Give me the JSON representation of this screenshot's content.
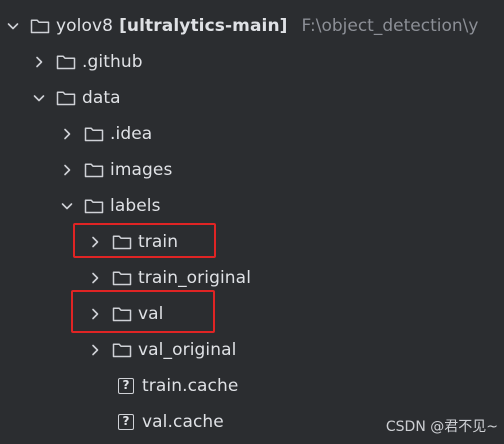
{
  "tree": {
    "root": {
      "name": "yolov8",
      "module": "[ultralytics-main]",
      "path": "F:\\object_detection\\y"
    },
    "items": [
      {
        "name": ".github",
        "kind": "folder",
        "state": "collapsed"
      },
      {
        "name": "data",
        "kind": "folder",
        "state": "expanded"
      },
      {
        "name": ".idea",
        "kind": "folder",
        "state": "collapsed"
      },
      {
        "name": "images",
        "kind": "folder",
        "state": "collapsed"
      },
      {
        "name": "labels",
        "kind": "folder",
        "state": "expanded"
      },
      {
        "name": "train",
        "kind": "folder",
        "state": "collapsed",
        "highlighted": true
      },
      {
        "name": "train_original",
        "kind": "folder",
        "state": "collapsed"
      },
      {
        "name": "val",
        "kind": "folder",
        "state": "collapsed",
        "highlighted": true
      },
      {
        "name": "val_original",
        "kind": "folder",
        "state": "collapsed"
      },
      {
        "name": "train.cache",
        "kind": "file-unknown",
        "icon_glyph": "?"
      },
      {
        "name": "val.cache",
        "kind": "file-unknown",
        "icon_glyph": "?"
      }
    ]
  },
  "icons": {
    "chevron_expanded": "chevron-down-icon",
    "chevron_collapsed": "chevron-right-icon",
    "folder": "folder-icon",
    "unknown_file": "unknown-file-icon"
  },
  "colors": {
    "background": "#2b2d30",
    "text": "#dfe1e5",
    "muted_text": "#8c8f96",
    "highlight_border": "#e02424"
  },
  "watermark": "CSDN @君不见~"
}
